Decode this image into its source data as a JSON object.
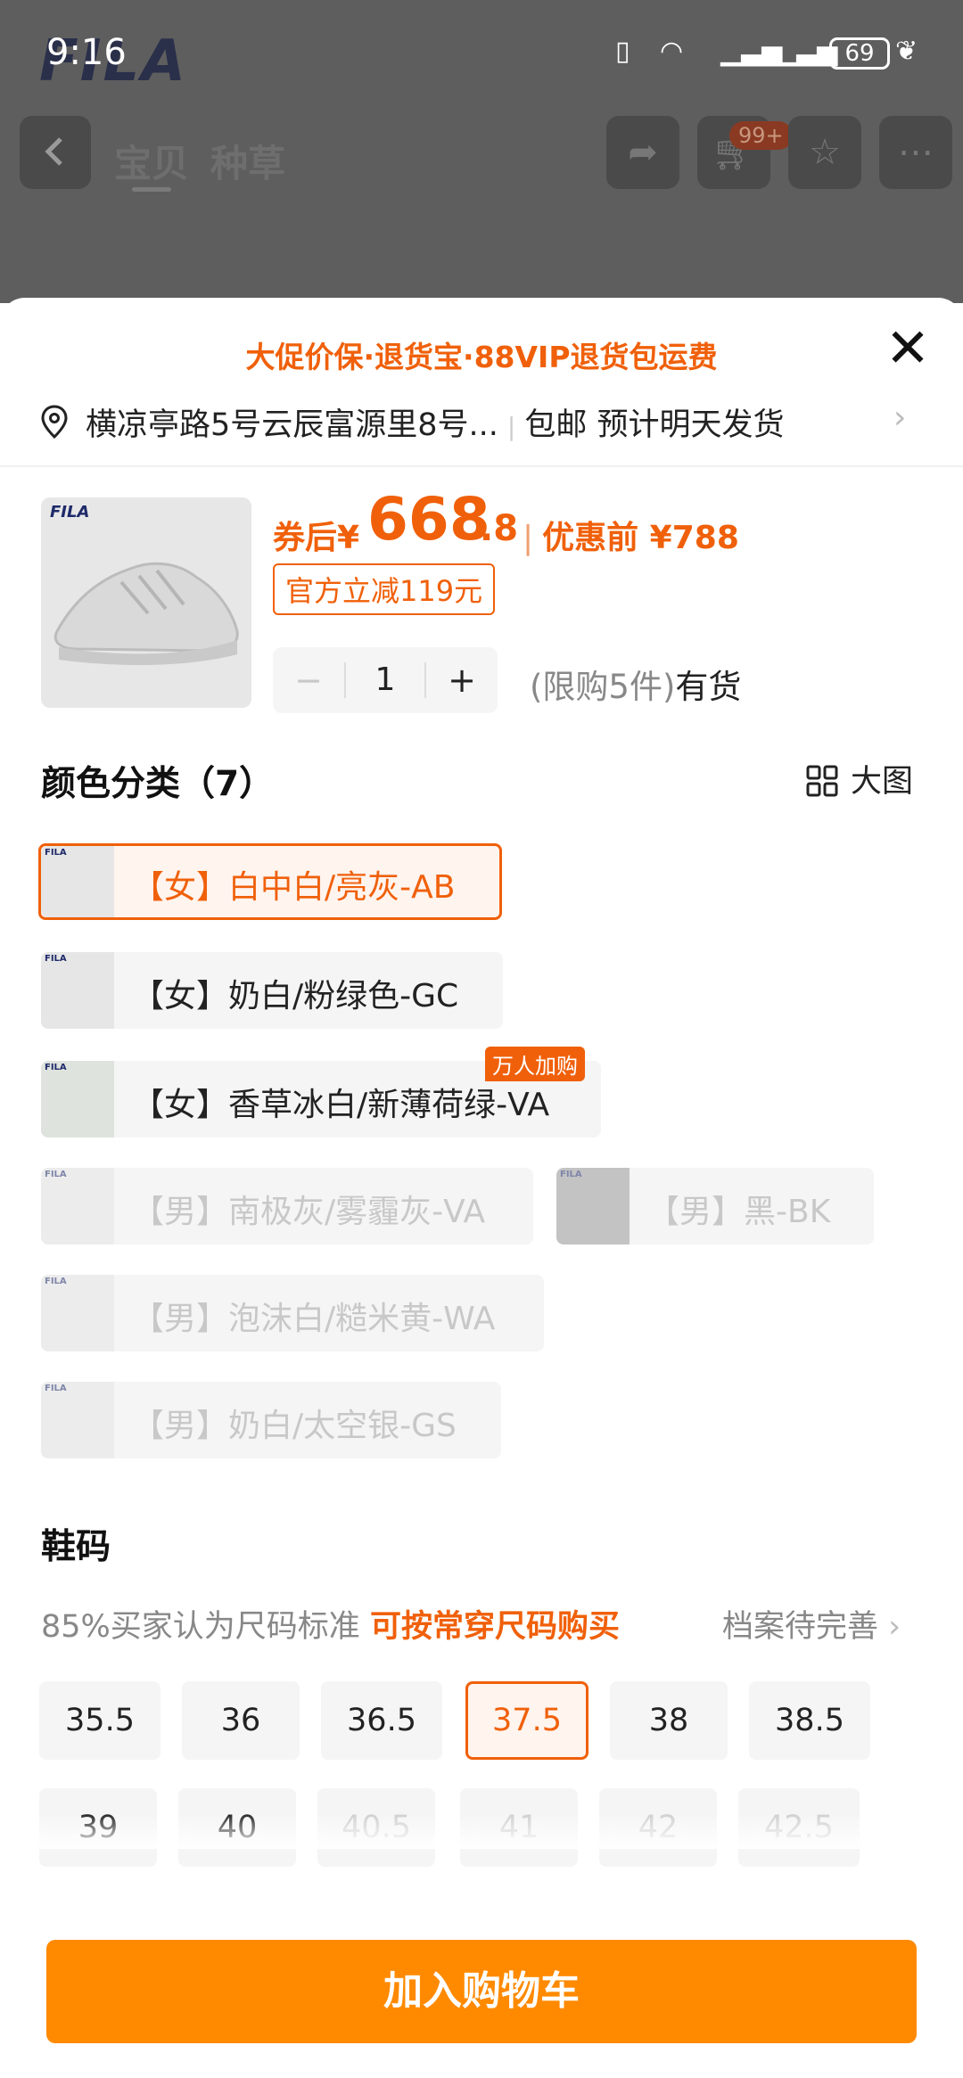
{
  "status_bar": {
    "time": "9:16",
    "battery": "69"
  },
  "brand_logo": "FILA",
  "nav": {
    "tab_item": "宝贝",
    "tab_review": "种草",
    "cart_badge": "99+"
  },
  "sheet": {
    "promo": "大促价保·退货宝·88VIP退货包运费",
    "address": "横凉亭路5号云辰富源里8号...",
    "shipping": "包邮 预计明天发货",
    "price": {
      "label": "券后",
      "currency": "¥",
      "integer": "668",
      "decimal": ".8",
      "original": "优惠前 ¥788"
    },
    "discount_tag": "官方立减119元",
    "quantity": {
      "minus": "−",
      "value": "1",
      "plus": "+"
    },
    "limit": "(限购5件)",
    "stock": "有货",
    "color_title": "颜色分类（7）",
    "big_image_label": "大图",
    "colors": [
      {
        "label": "【女】白中白/亮灰-AB",
        "state": "selected"
      },
      {
        "label": "【女】奶白/粉绿色-GC",
        "state": "available"
      },
      {
        "label": "【女】香草冰白/新薄荷绿-VA",
        "state": "available",
        "badge": "万人加购"
      },
      {
        "label": "【男】南极灰/雾霾灰-VA",
        "state": "disabled"
      },
      {
        "label": "【男】黑-BK",
        "state": "disabled"
      },
      {
        "label": "【男】泡沫白/糙米黄-WA",
        "state": "disabled"
      },
      {
        "label": "【男】奶白/太空银-GS",
        "state": "disabled"
      }
    ],
    "size_title": "鞋码",
    "fit_text": "85%买家认为尺码标准",
    "fit_highlight": "可按常穿尺码购买",
    "profile_text": "档案待完善",
    "sizes": [
      {
        "label": "35.5",
        "state": "available"
      },
      {
        "label": "36",
        "state": "available"
      },
      {
        "label": "36.5",
        "state": "available"
      },
      {
        "label": "37.5",
        "state": "selected"
      },
      {
        "label": "38",
        "state": "available"
      },
      {
        "label": "38.5",
        "state": "available"
      },
      {
        "label": "39",
        "state": "available"
      },
      {
        "label": "40",
        "state": "available"
      },
      {
        "label": "40.5",
        "state": "disabled"
      },
      {
        "label": "41",
        "state": "disabled"
      },
      {
        "label": "42",
        "state": "disabled"
      },
      {
        "label": "42.5",
        "state": "disabled"
      }
    ],
    "add_to_cart": "加入购物车"
  },
  "colors": {
    "accent": "#f0600a",
    "cart_button": "#ff8a00"
  }
}
